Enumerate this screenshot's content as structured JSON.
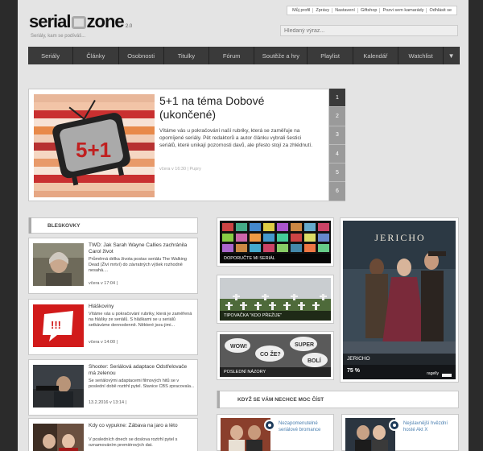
{
  "header": {
    "logo_word1": "serial",
    "logo_word2": "zone",
    "logo_version": "2.0",
    "slogan": "Seriály, kam se podíváš...",
    "top_links": [
      "Můj profil",
      "Zprávy",
      "Nastavení",
      "Giftshop",
      "Pozvi sem kamarády",
      "Odhlásit se"
    ],
    "search_placeholder": "Hledaný výraz..."
  },
  "nav": {
    "items": [
      "Seriály",
      "Články",
      "Osobnosti",
      "Titulky",
      "Fórum",
      "Soutěže a hry",
      "Playlist",
      "Kalendář",
      "Watchlist"
    ],
    "more_icon": "triangle-down"
  },
  "featured": {
    "title": "5+1 na téma Dobové (ukončené)",
    "description": "Vítáme vás u pokračování naší rubriky, která se zaměřuje na opomíjené seriály. Pět redaktorů a autor článku vybrali šestici seriálů, které unikají pozornosti davů, ale přesto stojí za zhlédnutí.",
    "meta": "včera v 16:30 | Pupry",
    "image_label": "5+1",
    "pages": [
      "1",
      "2",
      "3",
      "4",
      "5",
      "6"
    ],
    "active_page": 0
  },
  "bleskovky": {
    "heading": "BLESKOVKY",
    "items": [
      {
        "title": "TWD: Jak Sarah Wayne Callies zachránila Carol život",
        "text": "Průměrná délka života postav seriálu The Walking Dead (Živí mrtví) do závratných výšek rozhodně nesahá....",
        "date": "včera v 17:04 |"
      },
      {
        "title": "Hláškoviny",
        "text": "Vítáme vás u pokračování rubriky, která je zaměřená na hlášky ze seriálů. S hláškami se u seriálů setkáváme dennodenně. Některé jsou jimi...",
        "date": "včera v 14:00 |",
        "thumb_label": "!!!"
      },
      {
        "title": "Shooter: Seriálová adaptace Odstřelovače má zelenou",
        "text": "Se seriálovými adaptacemi filmových hitů se v poslední době roztrhl pytel. Stanice CBS zpracovala...",
        "date": "13.2.2016 v 13:14 |"
      },
      {
        "title": "Kdy co vypukne: Zábava na jaro a léto",
        "text": "V posledních dnech se doslova roztrhl pytel s oznamováním premiérových dat."
      }
    ]
  },
  "tiles": [
    {
      "caption": "DOPORUČTE MI SERIÁL"
    },
    {
      "caption": "TIPOVAČKA \"KDO PŘEŽIJE\""
    },
    {
      "caption": "POSLEDNÍ NÁZORY",
      "bubbles": [
        "WOW!",
        "CO ŽE?",
        "SUPER",
        "BOLÍ"
      ]
    }
  ],
  "poster": {
    "title_art": "JERICHO",
    "caption": "JERICHO",
    "rating": "75 %",
    "rater": "ragelly"
  },
  "recommend": {
    "heading": "KDYŽ SE VÁM NECHCE MOC ČÍST",
    "items": [
      {
        "title": "Nezapomenutelné seriálové bromance"
      },
      {
        "title": "Nejslavnější hvězdní hosté Akt X"
      }
    ]
  },
  "colors": {
    "nav_bg": "#3a3a3a",
    "page_bg": "#e4e4e4",
    "link": "#4a7fb0"
  }
}
